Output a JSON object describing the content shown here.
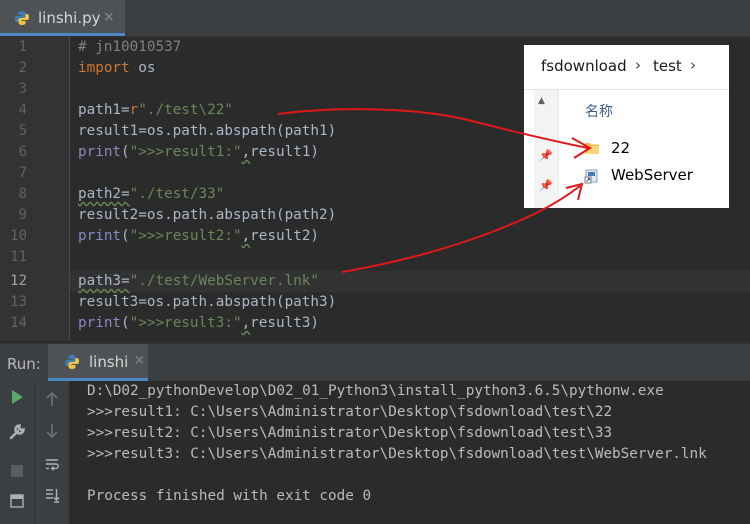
{
  "editor": {
    "tab": {
      "label": "linshi.py",
      "close": "×"
    },
    "line_numbers": [
      "1",
      "2",
      "3",
      "4",
      "5",
      "6",
      "7",
      "8",
      "9",
      "10",
      "11",
      "12",
      "13",
      "14"
    ],
    "active_line": "12",
    "lines": {
      "l1": {
        "comment": "# jn10010537"
      },
      "l2": {
        "kw": "import",
        "rest": " os"
      },
      "l4": {
        "var": "path1=",
        "prefix": "r",
        "str": "\"./test\\22\""
      },
      "l5": {
        "text": "result1=os.path.abspath(path1)"
      },
      "l6": {
        "fn": "print",
        "open": "(",
        "str": "\">>>result1:\"",
        "comma": ",",
        "rest": "result1)"
      },
      "l8": {
        "var": "path2=",
        "str": "\"./test/33\""
      },
      "l9": {
        "text": "result2=os.path.abspath(path2)"
      },
      "l10": {
        "fn": "print",
        "open": "(",
        "str": "\">>>result2:\"",
        "comma": ",",
        "rest": "result2)"
      },
      "l12": {
        "var": "path3=",
        "str": "\"./test/WebServer.lnk\""
      },
      "l13": {
        "text": "result3=os.path.abspath(path3)"
      },
      "l14": {
        "fn": "print",
        "open": "(",
        "str": "\">>>result3:\"",
        "comma": ",",
        "rest": "result3)"
      }
    }
  },
  "explorer": {
    "breadcrumb": [
      "fsdownload",
      "test"
    ],
    "chevron": "›",
    "column_header": "名称",
    "items": [
      {
        "name": "22",
        "icon": "folder-icon"
      },
      {
        "name": "WebServer",
        "icon": "shortcut-icon"
      }
    ]
  },
  "run": {
    "label": "Run:",
    "tab_label": "linshi",
    "close": "×",
    "output": [
      "D:\\D02_pythonDevelop\\D02_01_Python3\\install_python3.6.5\\pythonw.exe",
      ">>>result1: C:\\Users\\Administrator\\Desktop\\fsdownload\\test\\22",
      ">>>result2: C:\\Users\\Administrator\\Desktop\\fsdownload\\test\\33",
      ">>>result3: C:\\Users\\Administrator\\Desktop\\fsdownload\\test\\WebServer.lnk",
      "",
      "Process finished with exit code 0"
    ]
  },
  "colors": {
    "keyword": "#cc7832",
    "string": "#6a8759",
    "builtin": "#8888c6",
    "comment": "#808080",
    "annotation_arrow": "#e01818"
  }
}
